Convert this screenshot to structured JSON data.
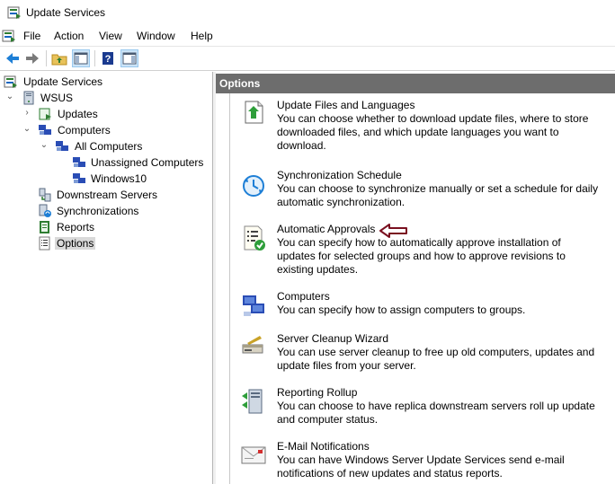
{
  "window": {
    "title": "Update Services"
  },
  "menu": [
    "File",
    "Action",
    "View",
    "Window",
    "Help"
  ],
  "toolbar": {
    "buttons": [
      {
        "icon": "back-arrow-icon"
      },
      {
        "icon": "forward-arrow-icon"
      },
      {
        "icon": "up-folder-icon"
      },
      {
        "icon": "show-hide-tree-icon"
      },
      {
        "icon": "help-icon"
      },
      {
        "icon": "show-hide-action-pane-icon"
      }
    ]
  },
  "tree": {
    "root": "Update Services",
    "server": "WSUS",
    "updates": "Updates",
    "computers": "Computers",
    "all_computers": "All Computers",
    "unassigned": "Unassigned Computers",
    "windows10": "Windows10",
    "downstream": "Downstream Servers",
    "synchronizations": "Synchronizations",
    "reports": "Reports",
    "options": "Options"
  },
  "panel": {
    "title": "Options"
  },
  "options": [
    {
      "title": "Update Files and Languages",
      "desc": "You can choose whether to download update files, where to store downloaded files, and which update languages you want to download.",
      "icon": "update-files-icon"
    },
    {
      "title": "Synchronization Schedule",
      "desc": "You can choose to synchronize manually or set a schedule for daily automatic synchronization.",
      "icon": "sync-schedule-icon"
    },
    {
      "title": "Automatic Approvals",
      "desc": "You can specify how to automatically approve installation of updates for selected groups and how to approve revisions to existing updates.",
      "icon": "automatic-approvals-icon"
    },
    {
      "title": "Computers",
      "desc": "You can specify how to assign computers to groups.",
      "icon": "computers-icon"
    },
    {
      "title": "Server Cleanup Wizard",
      "desc": "You can use server cleanup to free up old computers, updates and update files from your server.",
      "icon": "cleanup-wizard-icon"
    },
    {
      "title": "Reporting Rollup",
      "desc": "You can choose to have replica downstream servers roll up update and computer status.",
      "icon": "reporting-rollup-icon"
    },
    {
      "title": "E-Mail Notifications",
      "desc": "You can have Windows Server Update Services send e-mail notifications of new updates and status reports.",
      "icon": "email-notifications-icon"
    }
  ],
  "colors": {
    "panel_header": "#6d6d6d",
    "selection": "#d9d9d9",
    "annotation_arrow": "#7a1020"
  }
}
